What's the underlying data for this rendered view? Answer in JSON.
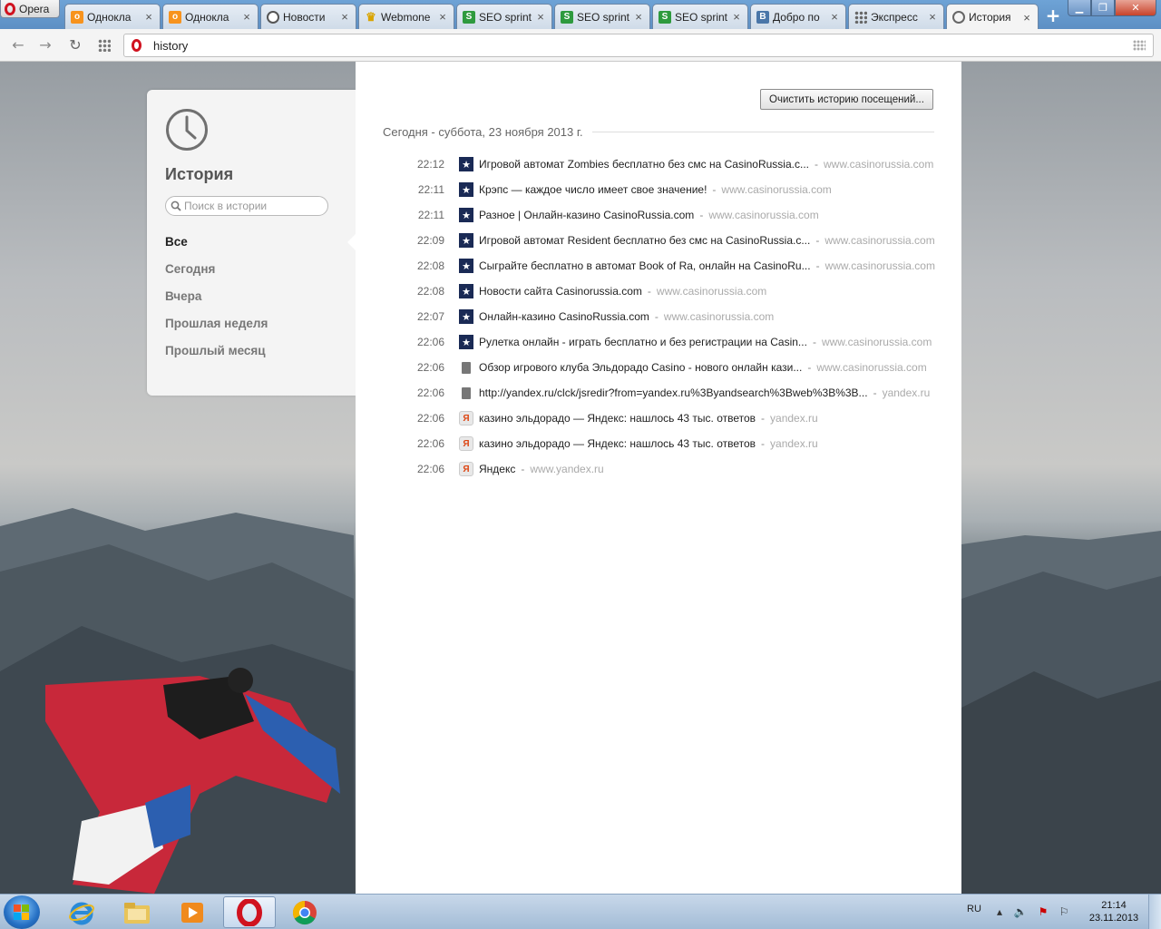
{
  "browser": {
    "menu_label": "Opera",
    "tabs": [
      {
        "label": "Однокла",
        "icon": "odnoklassniki-icon",
        "color": "#f7931e"
      },
      {
        "label": "Однокла",
        "icon": "odnoklassniki-icon",
        "color": "#f7931e"
      },
      {
        "label": "Новости",
        "icon": "news-globe-icon",
        "color": "#555555"
      },
      {
        "label": "Webmone",
        "icon": "trophy-icon",
        "color": "#d9a400"
      },
      {
        "label": "SEO sprint",
        "icon": "seosprint-icon",
        "color": "#2e9a3e"
      },
      {
        "label": "SEO sprint",
        "icon": "seosprint-icon",
        "color": "#2e9a3e"
      },
      {
        "label": "SEO sprint",
        "icon": "seosprint-icon",
        "color": "#2e9a3e"
      },
      {
        "label": "Добро по",
        "icon": "vk-icon",
        "color": "#4a76a8"
      },
      {
        "label": "Экспресс",
        "icon": "speed-dial-icon",
        "color": "#666666"
      },
      {
        "label": "История",
        "icon": "clock-icon",
        "color": "#666666",
        "active": true
      }
    ],
    "new_tab_label": "+",
    "address": "history"
  },
  "history": {
    "title": "История",
    "search_placeholder": "Поиск в истории",
    "filters": [
      "Все",
      "Сегодня",
      "Вчера",
      "Прошлая неделя",
      "Прошлый месяц"
    ],
    "selected_filter": "Все",
    "clear_button": "Очистить историю посещений...",
    "day_heading": "Сегодня - суббота, 23 ноября 2013 г.",
    "separator": "-",
    "entries": [
      {
        "time": "22:12",
        "favicon": "casinorussia",
        "title": "Игровой автомат Zombies бесплатно без смс на CasinoRussia.c...",
        "domain": "www.casinorussia.com"
      },
      {
        "time": "22:11",
        "favicon": "casinorussia",
        "title": "Крэпс — каждое число имеет свое значение!",
        "domain": "www.casinorussia.com"
      },
      {
        "time": "22:11",
        "favicon": "casinorussia",
        "title": "Разное | Онлайн-казино CasinoRussia.com",
        "domain": "www.casinorussia.com"
      },
      {
        "time": "22:09",
        "favicon": "casinorussia",
        "title": "Игровой автомат Resident бесплатно без смс на CasinoRussia.c...",
        "domain": "www.casinorussia.com"
      },
      {
        "time": "22:08",
        "favicon": "casinorussia",
        "title": "Сыграйте бесплатно в автомат Book of Ra, онлайн на CasinoRu...",
        "domain": "www.casinorussia.com"
      },
      {
        "time": "22:08",
        "favicon": "casinorussia",
        "title": "Новости сайта Casinorussia.com",
        "domain": "www.casinorussia.com"
      },
      {
        "time": "22:07",
        "favicon": "casinorussia",
        "title": "Онлайн-казино CasinoRussia.com",
        "domain": "www.casinorussia.com"
      },
      {
        "time": "22:06",
        "favicon": "casinorussia",
        "title": "Рулетка онлайн - играть бесплатно и без регистрации на Casin...",
        "domain": "www.casinorussia.com"
      },
      {
        "time": "22:06",
        "favicon": "document",
        "title": "Обзор игрового клуба Эльдорадо Casino - нового онлайн кази...",
        "domain": "www.casinorussia.com"
      },
      {
        "time": "22:06",
        "favicon": "document",
        "title": "http://yandex.ru/clck/jsredir?from=yandex.ru%3Byandsearch%3Bweb%3B%3B...",
        "domain": "yandex.ru"
      },
      {
        "time": "22:06",
        "favicon": "yandex",
        "title": "казино эльдорадо — Яндекс: нашлось 43 тыс. ответов",
        "domain": "yandex.ru"
      },
      {
        "time": "22:06",
        "favicon": "yandex",
        "title": "казино эльдорадо — Яндекс: нашлось 43 тыс. ответов",
        "domain": "yandex.ru"
      },
      {
        "time": "22:06",
        "favicon": "yandex",
        "title": "Яндекс",
        "domain": "www.yandex.ru"
      }
    ]
  },
  "taskbar": {
    "apps": [
      "internet-explorer-icon",
      "file-explorer-icon",
      "media-player-icon",
      "opera-icon",
      "chrome-icon"
    ],
    "active_app": "opera-icon",
    "language": "RU",
    "time": "21:14",
    "date": "23.11.2013"
  }
}
